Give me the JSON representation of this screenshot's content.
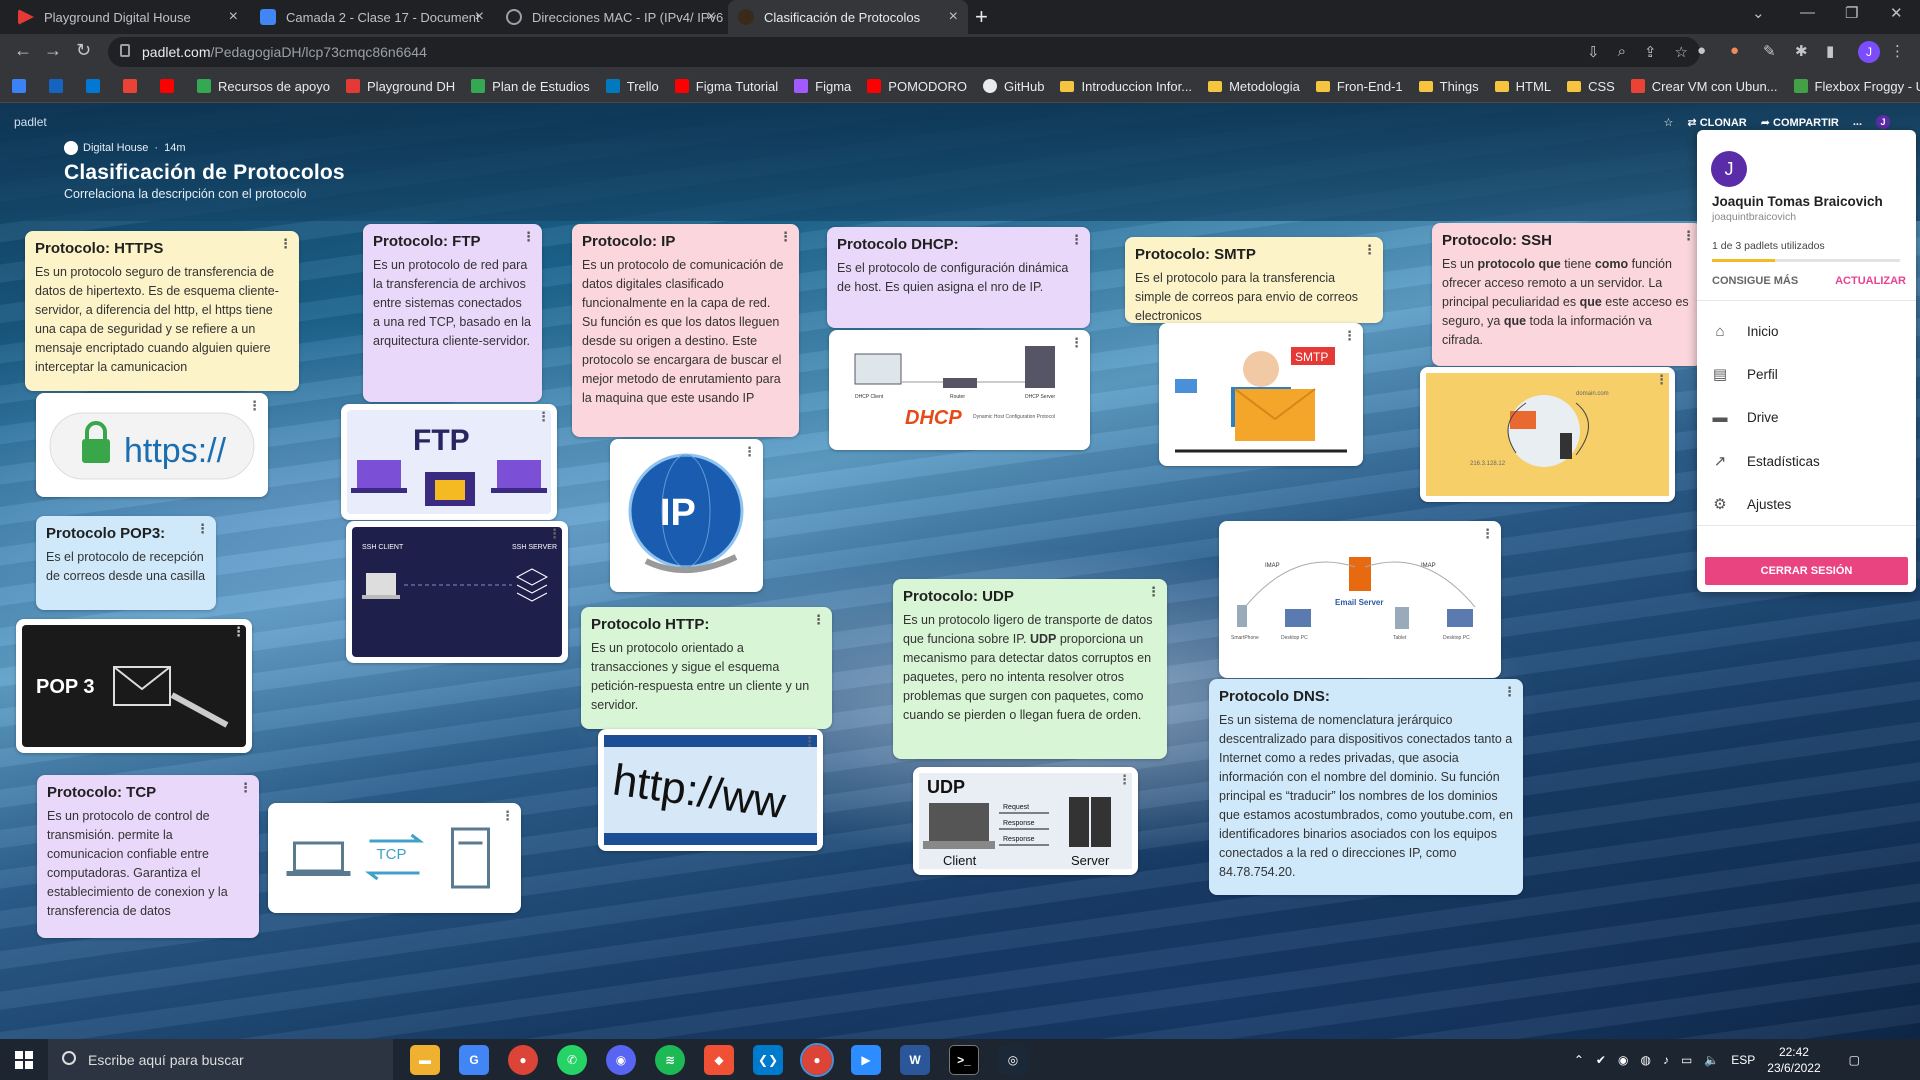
{
  "browser": {
    "tabs": [
      {
        "label": "Playground Digital House",
        "color": "#e53935"
      },
      {
        "label": "Camada 2 - Clase 17 - Document",
        "color": "#4285f4"
      },
      {
        "label": "Direcciones MAC - IP (IPv4/ IPv6",
        "color": "#9aa0a6"
      },
      {
        "label": "Clasificación de Protocolos",
        "color": "#f5b921"
      }
    ],
    "url_domain": "padlet.com",
    "url_path": "/PedagogiaDH/lcp73cmqc86n6644",
    "avatar_letter": "J",
    "bookmarks": [
      "Recursos de apoyo",
      "Playground DH",
      "Plan de Estudios",
      "Trello",
      "Figma Tutorial",
      "Figma",
      "POMODORO",
      "GitHub",
      "Introduccion Infor...",
      "Metodologia",
      "Fron-End-1",
      "Things",
      "HTML",
      "CSS",
      "Crear VM con Ubun...",
      "Flexbox Froggy - U..."
    ]
  },
  "padlet": {
    "brand": "padlet",
    "actions": {
      "clone": "CLONAR",
      "share": "COMPARTIR",
      "more": "...",
      "avatar": "J"
    },
    "author": "Digital House",
    "time": "14m",
    "title": "Clasificación de Protocolos",
    "subtitle": "Correlaciona la descripción con el protocolo"
  },
  "cards": {
    "https": {
      "title": "Protocolo: HTTPS",
      "body": "Es un protocolo seguro de transferencia de datos de hipertexto. Es de esquema cliente-servidor, a diferencia del http, el https tiene una capa de seguridad y se refiere a un mensaje encriptado cuando alguien quiere interceptar la camunicacion"
    },
    "ftp": {
      "title": "Protocolo: FTP",
      "body": "Es un protocolo de red para la transferencia de archivos entre sistemas conectados a una red TCP, basado en la arquitectura cliente-servidor."
    },
    "ip": {
      "title": "Protocolo: IP",
      "body": "Es un protocolo de comunicación de datos digitales clasificado funcionalmente en la capa de red. Su función es que los datos lleguen desde su origen a destino. Este protocolo se encargara de buscar el mejor metodo de enrutamiento para la maquina que este usando IP"
    },
    "dhcp": {
      "title": "Protocolo DHCP:",
      "body": "Es el protocolo de configuración dinámica de host. Es quien asigna el nro de IP."
    },
    "smtp": {
      "title": "Protocolo: SMTP",
      "body": "Es el protocolo para la transferencia simple de correos para envio de correos electronicos"
    },
    "ssh": {
      "title": "Protocolo: SSH",
      "body_parts": [
        "Es un ",
        "protocolo que",
        " tiene ",
        "como",
        " función ofrecer acceso remoto a un servidor. La principal peculiaridad es ",
        "que",
        " este acceso es seguro, ya ",
        "que",
        " toda la información va cifrada."
      ]
    },
    "pop3": {
      "title": "Protocolo POP3:",
      "body": "Es el protocolo de recepción de correos desde una casilla"
    },
    "http": {
      "title": "Protocolo HTTP:",
      "body": "Es un protocolo orientado a transacciones y sigue el esquema petición-respuesta entre un cliente y un servidor."
    },
    "udp": {
      "title": "Protocolo: UDP",
      "body_a": "Es un protocolo ligero de transporte de datos que funciona sobre IP. ",
      "body_bold": "UDP",
      "body_b": " proporciona un mecanismo para detectar datos corruptos en paquetes, pero no intenta resolver otros problemas que surgen con paquetes, como cuando se pierden o llegan fuera de orden."
    },
    "dns": {
      "title": "Protocolo DNS:",
      "body": "Es un sistema de nomenclatura jerárquico descentralizado para dispositivos conectados tanto a Internet como a redes privadas, que asocia información con el nombre del dominio. Su función principal es “traducir” los nombres de los dominios que estamos acostumbrados, como youtube.com, en identificadores binarios asociados con los equipos conectados a la red o direcciones IP, como 84.78.754.20."
    },
    "tcp": {
      "title": "Protocolo: TCP",
      "body": "Es un protocolo de control de transmisión. permite la comunicacion confiable entre computadoras. Garantiza el establecimiento de conexion y la transferencia de datos"
    }
  },
  "images": {
    "https_text": "https://",
    "ftp_text": "FTP",
    "ssh_client": "SSH CLIENT",
    "ssh_server": "SSH SERVER",
    "ip_text": "IP",
    "dhcp_text": "DHCP",
    "dhcp_sub": "Dynamic Host Configuration Protocol",
    "dhcp_client": "DHCP Client",
    "dhcp_router": "Router",
    "dhcp_server": "DHCP Server",
    "smtp_text": "SMTP",
    "ssh_domain": "domain.com",
    "ssh_ip": "216.3.128.12",
    "pop3_text": "POP 3",
    "http_text": "http://ww",
    "tcp_text": "TCP",
    "udp_text": "UDP",
    "udp_request": "Request",
    "udp_response": "Response",
    "udp_client": "Client",
    "udp_server": "Server",
    "email_server": "Email Server",
    "imap": "IMAP",
    "dns_devices": [
      "SmartPhone",
      "Desktop PC",
      "Tablet",
      "Desktop PC"
    ]
  },
  "menu": {
    "avatar": "J",
    "name": "Joaquin Tomas Braicovich",
    "username": "joaquintbraicovich",
    "usage": "1 de 3 padlets utilizados",
    "usage_fraction": 0.333,
    "more": "CONSIGUE MÁS",
    "update": "ACTUALIZAR",
    "items": [
      "Inicio",
      "Perfil",
      "Drive",
      "Estadísticas",
      "Ajustes"
    ],
    "logout": "CERRAR SESIÓN"
  },
  "taskbar": {
    "search": "Escribe aquí para buscar",
    "lang": "ESP",
    "time": "22:42",
    "date": "23/6/2022"
  }
}
